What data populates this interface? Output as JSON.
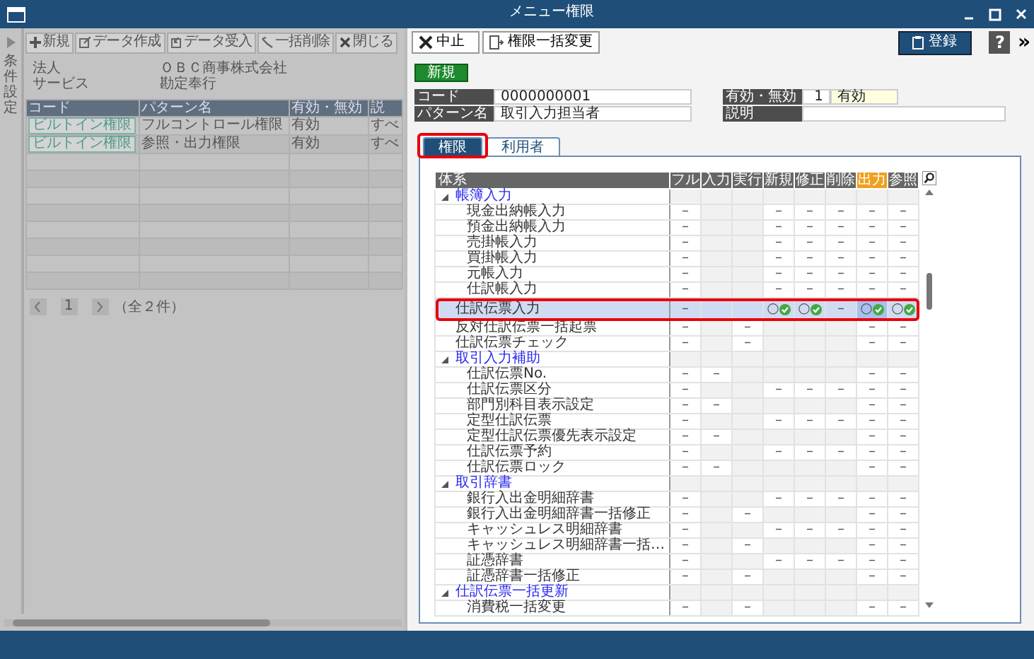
{
  "window": {
    "title": "メニュー権限"
  },
  "left_panel": {
    "side_tab": "条件設定",
    "toolbar": [
      {
        "label": "新規"
      },
      {
        "label": "データ作成"
      },
      {
        "label": "データ受入"
      },
      {
        "label": "一括削除"
      },
      {
        "label": "閉じる"
      }
    ],
    "info": [
      {
        "label": "法人",
        "value": "ＯＢＣ商事株式会社"
      },
      {
        "label": "サービス",
        "value": "勘定奉行"
      }
    ],
    "table": {
      "columns": [
        "コード",
        "パターン名",
        "有効・無効",
        "説"
      ],
      "rows": [
        {
          "code": "ビルトイン権限",
          "name": "フルコントロール権限",
          "status": "有効",
          "column_4": "すべ"
        },
        {
          "code": "ビルトイン権限",
          "name": "参照・出力権限",
          "status": "有効",
          "column_4": "すべ"
        }
      ]
    },
    "pager": {
      "page": "1",
      "total": "（全２件）"
    }
  },
  "dialog": {
    "toolbar": {
      "cancel": "中止",
      "bulk_change": "権限一括変更",
      "register": "登録",
      "help": "?",
      "more": "»"
    },
    "mode_badge": "新規",
    "fields": [
      {
        "label": "コード",
        "value": "0000000001"
      },
      {
        "label": "パターン名",
        "value": "取引入力担当者"
      },
      {
        "label": "有効・無効",
        "code": "1",
        "value": "有効"
      },
      {
        "label": "説明"
      }
    ],
    "tabs": [
      {
        "label": "権限",
        "selected": true,
        "outlined": true
      },
      {
        "label": "利用者",
        "selected": false,
        "outlined": false
      }
    ],
    "grid": {
      "columns": [
        {
          "label": "体系",
          "selected": false
        },
        {
          "label": "フル",
          "selected": false
        },
        {
          "label": "入力",
          "selected": false
        },
        {
          "label": "実行",
          "selected": false
        },
        {
          "label": "新規",
          "selected": false
        },
        {
          "label": "修正",
          "selected": false
        },
        {
          "label": "削除",
          "selected": false
        },
        {
          "label": "出力",
          "selected": true
        },
        {
          "label": "参照",
          "selected": false
        }
      ],
      "rows": [
        {
          "label": "帳簿入力",
          "selected": false,
          "outlined": false,
          "expanded": true,
          "children": [
            {
              "label": "現金出納帳入力",
              "selected": false,
              "outlined": false,
              "cells": [
                {
                  "kind": "dash",
                  "text": "–"
                },
                {
                  "kind": "blank"
                },
                {
                  "kind": "blank"
                },
                {
                  "kind": "dash",
                  "text": "–"
                },
                {
                  "kind": "dash",
                  "text": "–"
                },
                {
                  "kind": "dash",
                  "text": "–"
                },
                {
                  "kind": "dash",
                  "text": "–"
                },
                {
                  "kind": "dash",
                  "text": "–"
                }
              ]
            },
            {
              "label": "預金出納帳入力",
              "selected": false,
              "outlined": false,
              "cells": [
                {
                  "kind": "dash",
                  "text": "–"
                },
                {
                  "kind": "blank"
                },
                {
                  "kind": "blank"
                },
                {
                  "kind": "dash",
                  "text": "–"
                },
                {
                  "kind": "dash",
                  "text": "–"
                },
                {
                  "kind": "dash",
                  "text": "–"
                },
                {
                  "kind": "dash",
                  "text": "–"
                },
                {
                  "kind": "dash",
                  "text": "–"
                }
              ]
            },
            {
              "label": "売掛帳入力",
              "selected": false,
              "outlined": false,
              "cells": [
                {
                  "kind": "dash",
                  "text": "–"
                },
                {
                  "kind": "blank"
                },
                {
                  "kind": "blank"
                },
                {
                  "kind": "dash",
                  "text": "–"
                },
                {
                  "kind": "dash",
                  "text": "–"
                },
                {
                  "kind": "dash",
                  "text": "–"
                },
                {
                  "kind": "dash",
                  "text": "–"
                },
                {
                  "kind": "dash",
                  "text": "–"
                }
              ]
            },
            {
              "label": "買掛帳入力",
              "selected": false,
              "outlined": false,
              "cells": [
                {
                  "kind": "dash",
                  "text": "–"
                },
                {
                  "kind": "blank"
                },
                {
                  "kind": "blank"
                },
                {
                  "kind": "dash",
                  "text": "–"
                },
                {
                  "kind": "dash",
                  "text": "–"
                },
                {
                  "kind": "dash",
                  "text": "–"
                },
                {
                  "kind": "dash",
                  "text": "–"
                },
                {
                  "kind": "dash",
                  "text": "–"
                }
              ]
            },
            {
              "label": "元帳入力",
              "selected": false,
              "outlined": false,
              "cells": [
                {
                  "kind": "dash",
                  "text": "–"
                },
                {
                  "kind": "blank"
                },
                {
                  "kind": "blank"
                },
                {
                  "kind": "dash",
                  "text": "–"
                },
                {
                  "kind": "dash",
                  "text": "–"
                },
                {
                  "kind": "dash",
                  "text": "–"
                },
                {
                  "kind": "dash",
                  "text": "–"
                },
                {
                  "kind": "dash",
                  "text": "–"
                }
              ]
            },
            {
              "label": "仕訳帳入力",
              "selected": false,
              "outlined": false,
              "cells": [
                {
                  "kind": "dash",
                  "text": "–"
                },
                {
                  "kind": "blank"
                },
                {
                  "kind": "blank"
                },
                {
                  "kind": "dash",
                  "text": "–"
                },
                {
                  "kind": "dash",
                  "text": "–"
                },
                {
                  "kind": "dash",
                  "text": "–"
                },
                {
                  "kind": "dash",
                  "text": "–"
                },
                {
                  "kind": "dash",
                  "text": "–"
                }
              ]
            }
          ]
        },
        {
          "label": "仕訳伝票入力",
          "selected": true,
          "outlined": true,
          "cells": [
            {
              "kind": "dash",
              "text": "–"
            },
            {
              "kind": "blank"
            },
            {
              "kind": "blank"
            },
            {
              "kind": "check",
              "text": "○"
            },
            {
              "kind": "check",
              "text": "○"
            },
            {
              "kind": "dash",
              "text": "–"
            },
            {
              "kind": "check",
              "text": "○"
            },
            {
              "kind": "check",
              "text": "○"
            }
          ]
        },
        {
          "label": "反対仕訳伝票一括起票",
          "selected": false,
          "outlined": false,
          "cells": [
            {
              "kind": "dash",
              "text": "–"
            },
            {
              "kind": "blank"
            },
            {
              "kind": "dash",
              "text": "–"
            },
            {
              "kind": "blank"
            },
            {
              "kind": "blank"
            },
            {
              "kind": "blank"
            },
            {
              "kind": "dash",
              "text": "–"
            },
            {
              "kind": "dash",
              "text": "–"
            }
          ]
        },
        {
          "label": "仕訳伝票チェック",
          "selected": false,
          "outlined": false,
          "cells": [
            {
              "kind": "dash",
              "text": "–"
            },
            {
              "kind": "blank"
            },
            {
              "kind": "dash",
              "text": "–"
            },
            {
              "kind": "blank"
            },
            {
              "kind": "blank"
            },
            {
              "kind": "blank"
            },
            {
              "kind": "dash",
              "text": "–"
            },
            {
              "kind": "dash",
              "text": "–"
            }
          ]
        },
        {
          "label": "取引入力補助",
          "selected": false,
          "outlined": false,
          "expanded": true,
          "children": [
            {
              "label": "仕訳伝票No.",
              "selected": false,
              "outlined": false,
              "cells": [
                {
                  "kind": "dash",
                  "text": "–"
                },
                {
                  "kind": "dash",
                  "text": "–"
                },
                {
                  "kind": "blank"
                },
                {
                  "kind": "blank"
                },
                {
                  "kind": "blank"
                },
                {
                  "kind": "blank"
                },
                {
                  "kind": "dash",
                  "text": "–"
                },
                {
                  "kind": "dash",
                  "text": "–"
                }
              ]
            },
            {
              "label": "仕訳伝票区分",
              "selected": false,
              "outlined": false,
              "cells": [
                {
                  "kind": "dash",
                  "text": "–"
                },
                {
                  "kind": "blank"
                },
                {
                  "kind": "blank"
                },
                {
                  "kind": "dash",
                  "text": "–"
                },
                {
                  "kind": "dash",
                  "text": "–"
                },
                {
                  "kind": "dash",
                  "text": "–"
                },
                {
                  "kind": "dash",
                  "text": "–"
                },
                {
                  "kind": "dash",
                  "text": "–"
                }
              ]
            },
            {
              "label": "部門別科目表示設定",
              "selected": false,
              "outlined": false,
              "cells": [
                {
                  "kind": "dash",
                  "text": "–"
                },
                {
                  "kind": "dash",
                  "text": "–"
                },
                {
                  "kind": "blank"
                },
                {
                  "kind": "blank"
                },
                {
                  "kind": "blank"
                },
                {
                  "kind": "blank"
                },
                {
                  "kind": "dash",
                  "text": "–"
                },
                {
                  "kind": "dash",
                  "text": "–"
                }
              ]
            },
            {
              "label": "定型仕訳伝票",
              "selected": false,
              "outlined": false,
              "cells": [
                {
                  "kind": "dash",
                  "text": "–"
                },
                {
                  "kind": "blank"
                },
                {
                  "kind": "blank"
                },
                {
                  "kind": "dash",
                  "text": "–"
                },
                {
                  "kind": "dash",
                  "text": "–"
                },
                {
                  "kind": "dash",
                  "text": "–"
                },
                {
                  "kind": "dash",
                  "text": "–"
                },
                {
                  "kind": "dash",
                  "text": "–"
                }
              ]
            },
            {
              "label": "定型仕訳伝票優先表示設定",
              "selected": false,
              "outlined": false,
              "cells": [
                {
                  "kind": "dash",
                  "text": "–"
                },
                {
                  "kind": "dash",
                  "text": "–"
                },
                {
                  "kind": "blank"
                },
                {
                  "kind": "blank"
                },
                {
                  "kind": "blank"
                },
                {
                  "kind": "blank"
                },
                {
                  "kind": "dash",
                  "text": "–"
                },
                {
                  "kind": "dash",
                  "text": "–"
                }
              ]
            },
            {
              "label": "仕訳伝票予約",
              "selected": false,
              "outlined": false,
              "cells": [
                {
                  "kind": "dash",
                  "text": "–"
                },
                {
                  "kind": "blank"
                },
                {
                  "kind": "blank"
                },
                {
                  "kind": "dash",
                  "text": "–"
                },
                {
                  "kind": "dash",
                  "text": "–"
                },
                {
                  "kind": "dash",
                  "text": "–"
                },
                {
                  "kind": "dash",
                  "text": "–"
                },
                {
                  "kind": "dash",
                  "text": "–"
                }
              ]
            },
            {
              "label": "仕訳伝票ロック",
              "selected": false,
              "outlined": false,
              "cells": [
                {
                  "kind": "dash",
                  "text": "–"
                },
                {
                  "kind": "dash",
                  "text": "–"
                },
                {
                  "kind": "blank"
                },
                {
                  "kind": "blank"
                },
                {
                  "kind": "blank"
                },
                {
                  "kind": "blank"
                },
                {
                  "kind": "dash",
                  "text": "–"
                },
                {
                  "kind": "dash",
                  "text": "–"
                }
              ]
            }
          ]
        },
        {
          "label": "取引辞書",
          "selected": false,
          "outlined": false,
          "expanded": true,
          "children": [
            {
              "label": "銀行入出金明細辞書",
              "selected": false,
              "outlined": false,
              "cells": [
                {
                  "kind": "dash",
                  "text": "–"
                },
                {
                  "kind": "blank"
                },
                {
                  "kind": "blank"
                },
                {
                  "kind": "dash",
                  "text": "–"
                },
                {
                  "kind": "dash",
                  "text": "–"
                },
                {
                  "kind": "dash",
                  "text": "–"
                },
                {
                  "kind": "dash",
                  "text": "–"
                },
                {
                  "kind": "dash",
                  "text": "–"
                }
              ]
            },
            {
              "label": "銀行入出金明細辞書一括修正",
              "selected": false,
              "outlined": false,
              "cells": [
                {
                  "kind": "dash",
                  "text": "–"
                },
                {
                  "kind": "blank"
                },
                {
                  "kind": "dash",
                  "text": "–"
                },
                {
                  "kind": "blank"
                },
                {
                  "kind": "blank"
                },
                {
                  "kind": "blank"
                },
                {
                  "kind": "dash",
                  "text": "–"
                },
                {
                  "kind": "dash",
                  "text": "–"
                }
              ]
            },
            {
              "label": "キャッシュレス明細辞書",
              "selected": false,
              "outlined": false,
              "cells": [
                {
                  "kind": "dash",
                  "text": "–"
                },
                {
                  "kind": "blank"
                },
                {
                  "kind": "blank"
                },
                {
                  "kind": "dash",
                  "text": "–"
                },
                {
                  "kind": "dash",
                  "text": "–"
                },
                {
                  "kind": "dash",
                  "text": "–"
                },
                {
                  "kind": "dash",
                  "text": "–"
                },
                {
                  "kind": "dash",
                  "text": "–"
                }
              ]
            },
            {
              "label": "キャッシュレス明細辞書一括…",
              "selected": false,
              "outlined": false,
              "cells": [
                {
                  "kind": "dash",
                  "text": "–"
                },
                {
                  "kind": "blank"
                },
                {
                  "kind": "dash",
                  "text": "–"
                },
                {
                  "kind": "blank"
                },
                {
                  "kind": "blank"
                },
                {
                  "kind": "blank"
                },
                {
                  "kind": "dash",
                  "text": "–"
                },
                {
                  "kind": "dash",
                  "text": "–"
                }
              ]
            },
            {
              "label": "証憑辞書",
              "selected": false,
              "outlined": false,
              "cells": [
                {
                  "kind": "dash",
                  "text": "–"
                },
                {
                  "kind": "blank"
                },
                {
                  "kind": "blank"
                },
                {
                  "kind": "dash",
                  "text": "–"
                },
                {
                  "kind": "dash",
                  "text": "–"
                },
                {
                  "kind": "dash",
                  "text": "–"
                },
                {
                  "kind": "dash",
                  "text": "–"
                },
                {
                  "kind": "dash",
                  "text": "–"
                }
              ]
            },
            {
              "label": "証憑辞書一括修正",
              "selected": false,
              "outlined": false,
              "cells": [
                {
                  "kind": "dash",
                  "text": "–"
                },
                {
                  "kind": "blank"
                },
                {
                  "kind": "dash",
                  "text": "–"
                },
                {
                  "kind": "blank"
                },
                {
                  "kind": "blank"
                },
                {
                  "kind": "blank"
                },
                {
                  "kind": "dash",
                  "text": "–"
                },
                {
                  "kind": "dash",
                  "text": "–"
                }
              ]
            }
          ]
        },
        {
          "label": "仕訳伝票一括更新",
          "selected": false,
          "outlined": false,
          "expanded": true,
          "children": [
            {
              "label": "消費税一括変更",
              "selected": false,
              "outlined": false,
              "cells": [
                {
                  "kind": "dash",
                  "text": "–"
                },
                {
                  "kind": "blank"
                },
                {
                  "kind": "dash",
                  "text": "–"
                },
                {
                  "kind": "blank"
                },
                {
                  "kind": "blank"
                },
                {
                  "kind": "blank"
                },
                {
                  "kind": "dash",
                  "text": "–"
                },
                {
                  "kind": "dash",
                  "text": "–"
                }
              ]
            }
          ]
        }
      ]
    }
  }
}
